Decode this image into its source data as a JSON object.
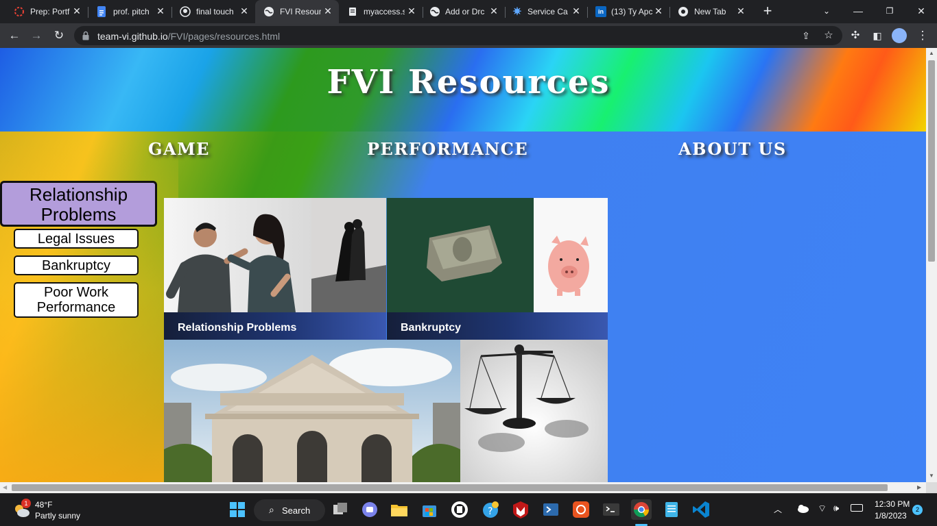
{
  "browser": {
    "tabs": [
      {
        "title": "Prep: Portf",
        "icon": "loading-ring-icon",
        "color": "#e94235"
      },
      {
        "title": "prof. pitch",
        "icon": "google-docs-icon",
        "color": "#4285f4"
      },
      {
        "title": "final touch",
        "icon": "github-icon",
        "color": "#ffffff"
      },
      {
        "title": "FVI Resour",
        "icon": "globe-icon",
        "color": "#ffffff",
        "active": true
      },
      {
        "title": "myaccess.s",
        "icon": "document-icon",
        "color": "#ffffff"
      },
      {
        "title": "Add or Drc",
        "icon": "globe-icon",
        "color": "#ffffff"
      },
      {
        "title": "Service Ca",
        "icon": "star-icon",
        "color": "#5fa8ff"
      },
      {
        "title": "(13) Ty Apc",
        "icon": "linkedin-icon",
        "color": "#0a66c2"
      },
      {
        "title": "New Tab",
        "icon": "chrome-icon",
        "color": "#ffffff"
      }
    ],
    "url_host": "team-vi.github.io",
    "url_path": "/FVI/pages/resources.html"
  },
  "page": {
    "title": "FVI Resources",
    "nav": {
      "game": "GAME",
      "performance": "PERFORMANCE",
      "about": "ABOUT US"
    },
    "sidebar": {
      "active": "Relationship Problems",
      "items": [
        "Legal Issues",
        "Bankruptcy",
        "Poor Work Performance"
      ]
    },
    "tiles": [
      {
        "caption": "Relationship Problems"
      },
      {
        "caption": "Bankruptcy"
      }
    ]
  },
  "taskbar": {
    "weather_temp": "48°F",
    "weather_desc": "Partly sunny",
    "weather_badge": "1",
    "search_label": "Search",
    "time": "12:30 PM",
    "date": "1/8/2023",
    "notifications": "2"
  }
}
